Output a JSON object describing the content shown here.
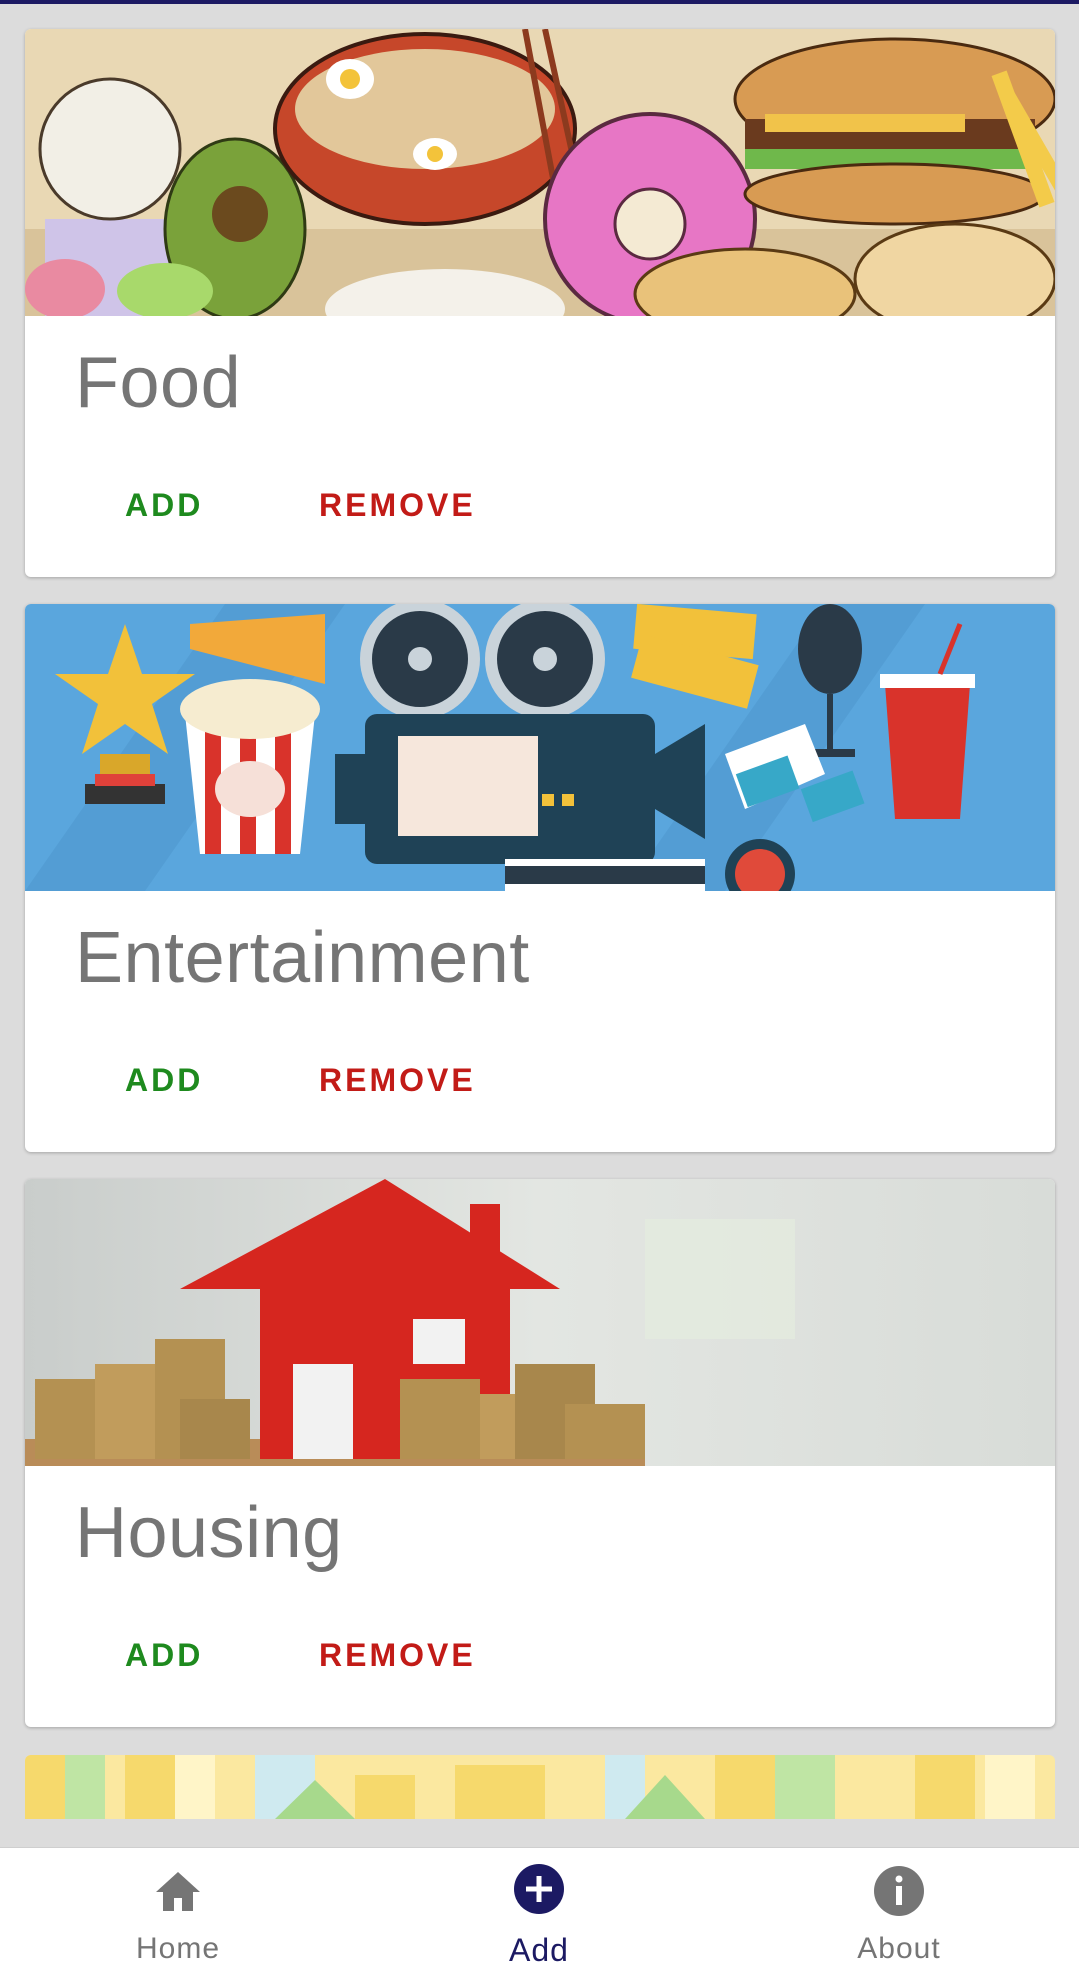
{
  "cards": [
    {
      "title": "Food",
      "add_label": "ADD",
      "remove_label": "REMOVE",
      "image": "food-collage-image"
    },
    {
      "title": "Entertainment",
      "add_label": "ADD",
      "remove_label": "REMOVE",
      "image": "cinema-illustration-image"
    },
    {
      "title": "Housing",
      "add_label": "ADD",
      "remove_label": "REMOVE",
      "image": "house-and-coins-image"
    }
  ],
  "partial_card": {
    "image": "city-buildings-image"
  },
  "bottom_nav": {
    "items": [
      {
        "label": "Home",
        "icon": "home-icon",
        "active": false
      },
      {
        "label": "Add",
        "icon": "add-circle-icon",
        "active": true
      },
      {
        "label": "About",
        "icon": "info-icon",
        "active": false
      }
    ]
  },
  "colors": {
    "primary": "#1c1a63",
    "add_button": "#1e8a1e",
    "remove_button": "#c21b17",
    "title_text": "#757575",
    "background": "#dcdcdc"
  }
}
